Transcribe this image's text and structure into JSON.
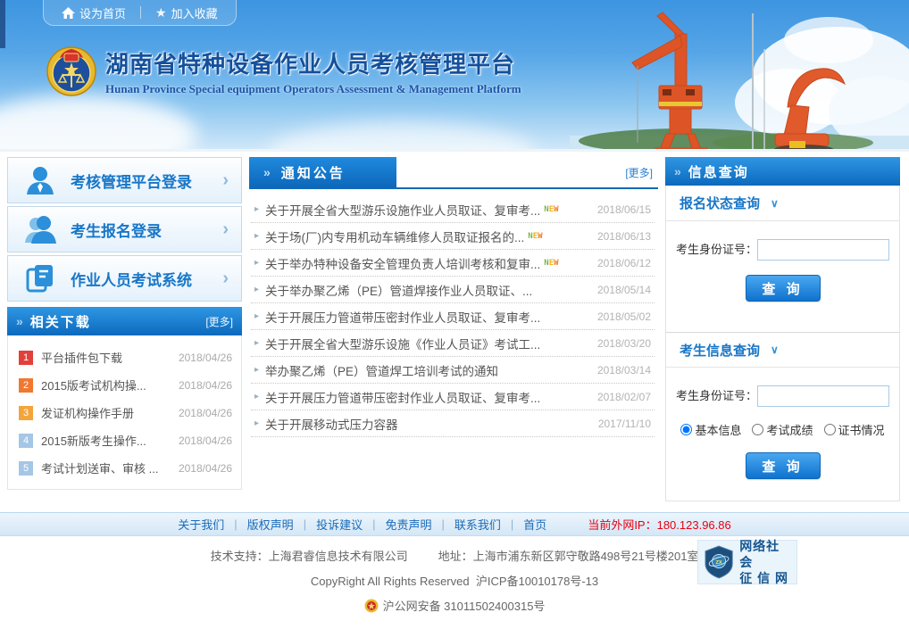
{
  "icons": {
    "double_arrow": "»",
    "chevron_right": "›",
    "chevron_down": "∨",
    "star": "★",
    "bullet": "▸"
  },
  "colors": {
    "header_blue_top": "#2f97e4",
    "header_blue_bottom": "#0c69bd",
    "accent_blue": "#1876c8",
    "link_blue": "#2a7fd0",
    "ip_red": "#e60012",
    "download_badge_colors": [
      "#e2403a",
      "#f07830",
      "#f3a53c",
      "#a5c6e5",
      "#a5c6e5"
    ]
  },
  "topbar": {
    "set_home": "设为首页",
    "add_favorite": "加入收藏"
  },
  "header": {
    "title": "湖南省特种设备作业人员考核管理平台",
    "subtitle": "Hunan Province Special equipment Operators Assessment & Management Platform"
  },
  "sidebar": {
    "menu": [
      {
        "label": "考核管理平台登录"
      },
      {
        "label": "考生报名登录"
      },
      {
        "label": "作业人员考试系统"
      }
    ],
    "downloads": {
      "title": "相关下载",
      "more": "[更多]",
      "items": [
        {
          "num": "1",
          "label": "平台插件包下载",
          "date": "2018/04/26"
        },
        {
          "num": "2",
          "label": "2015版考试机构操...",
          "date": "2018/04/26"
        },
        {
          "num": "3",
          "label": "发证机构操作手册",
          "date": "2018/04/26"
        },
        {
          "num": "4",
          "label": "2015新版考生操作...",
          "date": "2018/04/26"
        },
        {
          "num": "5",
          "label": "考试计划送审、审核 ...",
          "date": "2018/04/26"
        }
      ]
    }
  },
  "notices": {
    "title": "通知公告",
    "more": "[更多]",
    "badge_letters": [
      "N",
      "E",
      "W"
    ],
    "items": [
      {
        "title": "关于开展全省大型游乐设施作业人员取证、复审考...",
        "new": true,
        "date": "2018/06/15"
      },
      {
        "title": "关于场(厂)内专用机动车辆维修人员取证报名的...",
        "new": true,
        "date": "2018/06/13"
      },
      {
        "title": "关于举办特种设备安全管理负责人培训考核和复审...",
        "new": true,
        "date": "2018/06/12"
      },
      {
        "title": "关于举办聚乙烯（PE）管道焊接作业人员取证、...",
        "new": false,
        "date": "2018/05/14"
      },
      {
        "title": "关于开展压力管道带压密封作业人员取证、复审考...",
        "new": false,
        "date": "2018/05/02"
      },
      {
        "title": "关于开展全省大型游乐设施《作业人员证》考试工...",
        "new": false,
        "date": "2018/03/20"
      },
      {
        "title": "举办聚乙烯（PE）管道焊工培训考试的通知",
        "new": false,
        "date": "2018/03/14"
      },
      {
        "title": "关于开展压力管道带压密封作业人员取证、复审考...",
        "new": false,
        "date": "2018/02/07"
      },
      {
        "title": "关于开展移动式压力容器",
        "new": false,
        "date": "2017/11/10"
      }
    ]
  },
  "query_panel": {
    "title": "信息查询",
    "sections": [
      {
        "title": "报名状态查询",
        "label": "考生身份证号：",
        "value": "",
        "button": "查 询"
      },
      {
        "title": "考生信息查询",
        "label": "考生身份证号：",
        "value": "",
        "button": "查 询",
        "radios": [
          {
            "label": "基本信息",
            "checked": true
          },
          {
            "label": "考试成绩",
            "checked": false
          },
          {
            "label": "证书情况",
            "checked": false
          }
        ]
      }
    ]
  },
  "footer_nav": {
    "links": [
      "关于我们",
      "版权声明",
      "投诉建议",
      "免责声明",
      "联系我们",
      "首页"
    ],
    "separator": "|",
    "ip_text": "当前外网IP：180.123.96.86"
  },
  "footer": {
    "line1_support": "技术支持：上海君睿信息技术有限公司",
    "line1_address": "地址：上海市浦东新区郭守敬路498号21号楼201室",
    "line2_copyright": "CopyRight All Rights Reserved",
    "line2_icp": "沪ICP备10010178号-13",
    "line3_police": "沪公网安备 31011502400315号",
    "credit_line1": "网络社会",
    "credit_line2": "征 信 网"
  }
}
